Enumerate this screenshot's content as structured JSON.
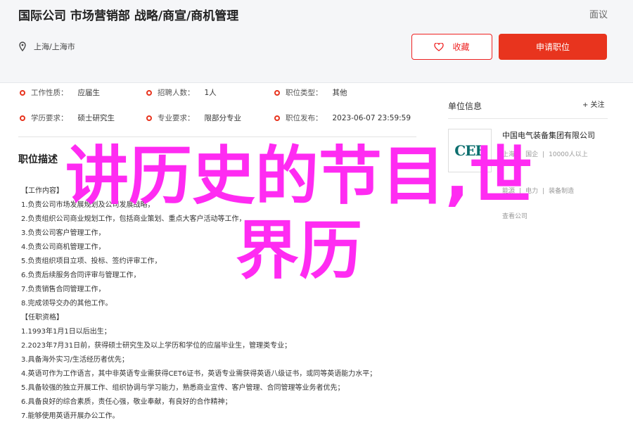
{
  "header": {
    "title": "国际公司 市场营销部 战略/商宣/商机管理",
    "report": "面议",
    "location": "上海/上海市",
    "fav_label": "收藏",
    "apply_label": "申请职位"
  },
  "info": [
    {
      "k": "工作性质：",
      "v": "应届生"
    },
    {
      "k": "招聘人数：",
      "v": "1人"
    },
    {
      "k": "职位类型：",
      "v": "其他"
    },
    {
      "k": "学历要求：",
      "v": "硕士研究生"
    },
    {
      "k": "专业要求：",
      "v": "限部分专业"
    },
    {
      "k": "职位发布：",
      "v": "2023-06-07 23:59:59"
    }
  ],
  "description": {
    "title": "职位描述",
    "lines": [
      "【工作内容】",
      "1.负责公司市场发展规划及公司发展战略，",
      "2.负责组织公司商业规划工作，包括商业策划、重点大客户活动等工作，",
      "3.负责公司客户管理工作，",
      "4.负责公司商机管理工作，",
      "5.负责组织项目立项、投标、签约评审工作，",
      "6.负责后续服务合同评审与管理工作，",
      "7.负责销售合同管理工作，",
      "8.完成领导交办的其他工作。",
      "【任职资格】",
      "1.1993年1月1日以后出生；",
      "2.2023年7月31日前，获得硕士研究生及以上学历和学位的应届毕业生，管理类专业；",
      "3.具备海外实习/生活经历者优先；",
      "4.英语可作为工作语言，其中非英语专业需获得CET6证书，英语专业需获得英语八级证书，或同等英语能力水平；",
      "5.具备较强的独立开展工作、组织协调与学习能力，熟悉商业宣传、客户管理、合同管理等业务者优先；",
      "6.具备良好的综合素质，责任心强，敬业奉献，有良好的合作精神；",
      "7.能够使用英语开展办公工作。"
    ]
  },
  "sidebar": {
    "title": "单位信息",
    "follow": "+ 关注",
    "company": "中国电气装备集团有限公司",
    "logo_text": "CEE",
    "meta1": [
      "上海",
      "|",
      "国企",
      "|",
      "10000人以上"
    ],
    "meta2": [
      "能源",
      "|",
      "电力",
      "|",
      "装备制造"
    ],
    "meta3": "查看公司"
  },
  "overlay": {
    "line1": "讲历史的节目,世",
    "line2": "界历"
  },
  "colors": {
    "accent": "#e8341e",
    "overlay": "#ff2bf2"
  }
}
